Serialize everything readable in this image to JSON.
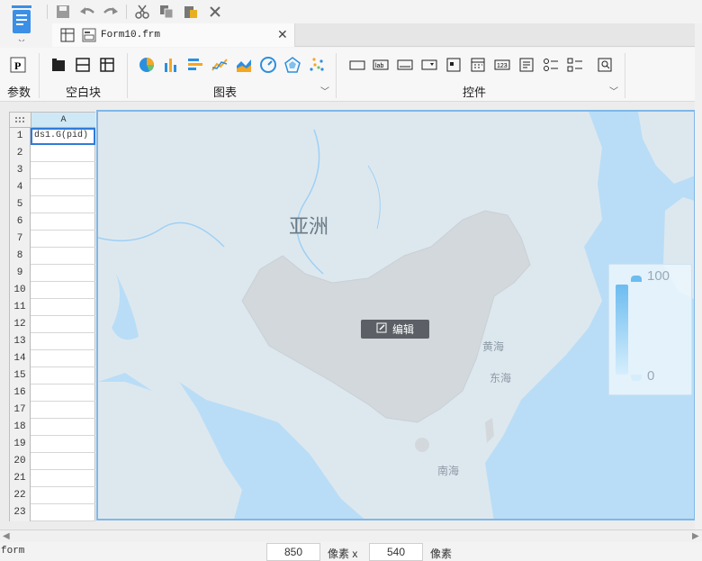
{
  "tab": {
    "filename": "Form10.frm"
  },
  "ribbon": {
    "groups": {
      "params": "参数",
      "blank_block": "空白块",
      "charts": "图表",
      "controls": "控件"
    }
  },
  "grid": {
    "column_header": "A",
    "rows": [
      "1",
      "2",
      "3",
      "4",
      "5",
      "6",
      "7",
      "8",
      "9",
      "10",
      "11",
      "12",
      "13",
      "14",
      "15",
      "16",
      "17",
      "18",
      "19",
      "20",
      "21",
      "22",
      "23"
    ],
    "a1_value": "ds1.G(pid)"
  },
  "map": {
    "asia_label": "亚洲",
    "yellow_sea": "黄海",
    "east_sea": "东海",
    "south_sea": "南海",
    "edit_label": "编辑",
    "legend_max": "100",
    "legend_min": "0",
    "colors": {
      "ocean": "#b9ddf7",
      "land": "#dde8ee",
      "china": "#d3d8dc",
      "legend": "#7cc4f2"
    }
  },
  "status": {
    "mode": "form",
    "width": "850",
    "unit1": "像素 x",
    "height": "540",
    "unit2": "像素"
  }
}
